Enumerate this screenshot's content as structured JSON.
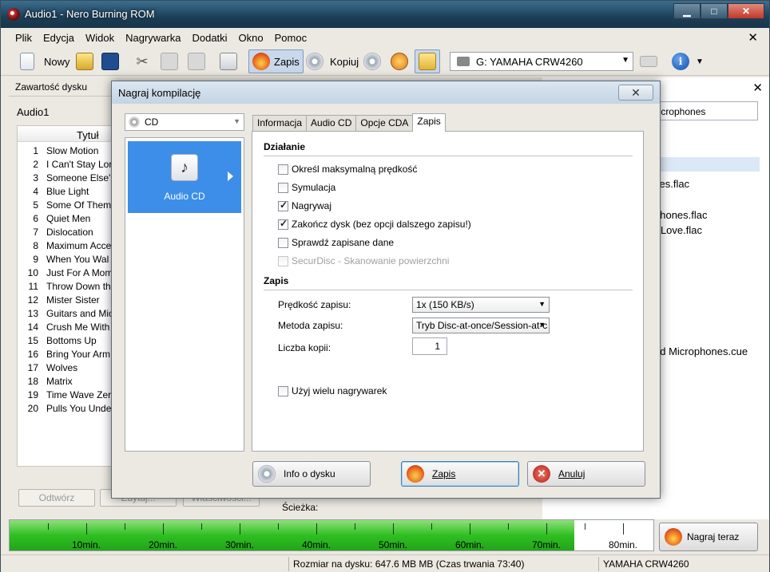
{
  "window": {
    "title": "Audio1 - Nero Burning ROM"
  },
  "menu": [
    "Plik",
    "Edycja",
    "Widok",
    "Nagrywarka",
    "Dodatki",
    "Okno",
    "Pomoc"
  ],
  "toolbar": {
    "new_label": "Nowy",
    "burn_label": "Zapis",
    "copy_label": "Kopiuj",
    "drive": "G: YAMAHA CRW4260"
  },
  "left_panel": {
    "header": "Zawartość dysku",
    "compilation": "Audio1",
    "column_title": "Tytuł",
    "tracks": [
      {
        "n": "1",
        "t": "Slow Motion"
      },
      {
        "n": "2",
        "t": "I Can't Stay Lor"
      },
      {
        "n": "3",
        "t": "Someone Else's"
      },
      {
        "n": "4",
        "t": "Blue Light"
      },
      {
        "n": "5",
        "t": "Some Of Them"
      },
      {
        "n": "6",
        "t": "Quiet Men"
      },
      {
        "n": "7",
        "t": "Dislocation"
      },
      {
        "n": "8",
        "t": "Maximum Acce"
      },
      {
        "n": "9",
        "t": "When You Wal"
      },
      {
        "n": "10",
        "t": "Just For A Mom"
      },
      {
        "n": "11",
        "t": "Throw Down th"
      },
      {
        "n": "12",
        "t": "Mister Sister"
      },
      {
        "n": "13",
        "t": "Guitars and Mic"
      },
      {
        "n": "14",
        "t": "Crush Me With"
      },
      {
        "n": "15",
        "t": "Bottoms Up"
      },
      {
        "n": "16",
        "t": "Bring Your Arm"
      },
      {
        "n": "17",
        "t": "Wolves"
      },
      {
        "n": "18",
        "t": "Matrix"
      },
      {
        "n": "19",
        "t": "Time Wave Zer"
      },
      {
        "n": "20",
        "t": "Pulls You Unde"
      }
    ],
    "play_button": "Odtwórz",
    "edit_button": "Edytuj...",
    "props_button": "Właściwości...",
    "path_label": "Ścieżka:"
  },
  "right_panel": {
    "search_value": "licrophones",
    "files": [
      "ses.flac",
      "phones.flac",
      "r Love.flac",
      "c",
      "c",
      "c",
      "nd Microphones.cue"
    ]
  },
  "capacity": {
    "labels": [
      "10min.",
      "20min.",
      "30min.",
      "40min.",
      "50min.",
      "60min.",
      "70min.",
      "80min."
    ],
    "max_minutes": 84,
    "used_minutes": 73.67,
    "burn_now": "Nagraj teraz"
  },
  "status": {
    "size": "Rozmiar na dysku: 647.6 MB MB (Czas trwania 73:40)",
    "drive": "YAMAHA   CRW4260"
  },
  "dialog": {
    "title": "Nagraj kompilację",
    "disc_type": "CD",
    "compilation_type": "Audio CD",
    "tabs": [
      "Informacja",
      "Audio CD",
      "Opcje CDA",
      "Zapis"
    ],
    "section_action": "Działanie",
    "options": [
      {
        "label": "Określ maksymalną prędkość",
        "checked": false,
        "disabled": false
      },
      {
        "label": "Symulacja",
        "checked": false,
        "disabled": false
      },
      {
        "label": "Nagrywaj",
        "checked": true,
        "disabled": false
      },
      {
        "label": "Zakończ dysk (bez opcji dalszego zapisu!)",
        "checked": true,
        "disabled": false
      },
      {
        "label": "Sprawdź zapisane dane",
        "checked": false,
        "disabled": false
      },
      {
        "label": "SecurDisc - Skanowanie powierzchni",
        "checked": false,
        "disabled": true
      }
    ],
    "section_write": "Zapis",
    "speed_label": "Prędkość zapisu:",
    "speed_value": "1x (150 KB/s)",
    "method_label": "Metoda zapisu:",
    "method_value": "Tryb Disc-at-once/Session-at-c",
    "copies_label": "Liczba kopii:",
    "copies_value": "1",
    "multi_label": "Użyj wielu nagrywarek",
    "btn_info": "Info o dysku",
    "btn_burn": "Zapis",
    "btn_cancel": "Anuluj"
  }
}
